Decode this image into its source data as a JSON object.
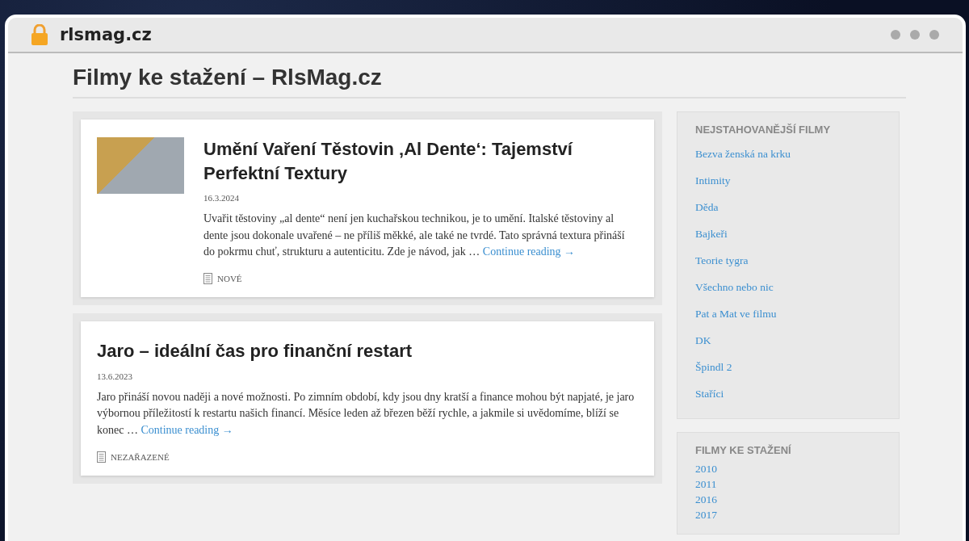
{
  "browser": {
    "address": "rlsmag.cz"
  },
  "site_title": "Filmy ke stažení – RlsMag.cz",
  "posts": [
    {
      "has_image": true,
      "title": " Umění Vaření Těstovin ‚Al Dente‘: Tajemství Perfektní Textury",
      "date": "16.3.2024",
      "excerpt": "Uvařit těstoviny „al dente“ není jen kuchařskou technikou, je to umění. Italské těstoviny al dente jsou dokonale uvařené – ne příliš měkké, ale také ne tvrdé. Tato správná textura přináší do pokrmu chuť, strukturu a autenticitu. Zde je návod, jak …",
      "more": "Continue reading →",
      "category": "NOVÉ"
    },
    {
      "has_image": false,
      "title": "Jaro – ideální čas pro finanční restart",
      "date": "13.6.2023",
      "excerpt": "Jaro přináší novou naději a nové možnosti. Po zimním období, kdy jsou dny kratší a finance mohou být napjaté, je jaro výbornou příležitostí k restartu našich financí. Měsíce leden až březen běží rychle, a jakmile si uvědomíme, blíží se konec …",
      "more": "Continue reading →",
      "category": "NEZAŘAZENÉ"
    }
  ],
  "sidebar": [
    {
      "kind": "spaced",
      "title": "NEJSTAHOVANĚJŠÍ FILMY",
      "links": [
        "Bezva ženská na krku",
        "Intimity",
        "Děda",
        "Bajkeři",
        "Teorie tygra",
        "Všechno nebo nic",
        "Pat a Mat ve filmu",
        "DK",
        "Špindl 2",
        "Staříci"
      ]
    },
    {
      "kind": "compact",
      "title": "FILMY KE STAŽENÍ",
      "links": [
        "2010",
        "2011",
        "2016",
        "2017"
      ]
    }
  ]
}
